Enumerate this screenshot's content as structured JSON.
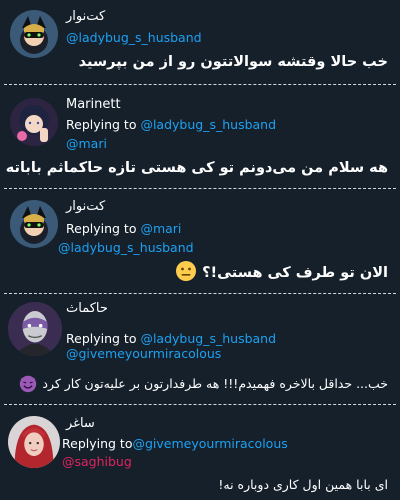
{
  "posts": [
    {
      "name": "کت‌نوار",
      "handle": "@ladybug_s_husband",
      "text": "خب حالا وقتشه سوالاتتون رو از من بپرسید",
      "avatar_icon": "cat-noir-avatar"
    },
    {
      "name": "Marinett",
      "reply_prefix": "Replying to ",
      "reply_to": "@ladybug_s_husband",
      "handle": "@mari",
      "text": "هه سلام من می‌دونم تو کی هستی تازه حاکماثم باباته",
      "avatar_icon": "marinette-avatar"
    },
    {
      "name": "کت‌نوار",
      "reply_prefix": "Replying to ",
      "reply_to": "@mari",
      "handle": "@ladybug_s_husband",
      "text": "الان تو طرف کی هستی!؟",
      "emoji": "neutral-face-emoji",
      "avatar_icon": "cat-noir-avatar"
    },
    {
      "name": "حاکماث",
      "reply_prefix": "Replying to ",
      "reply_to": "@ladybug_s_husband",
      "handle": "@givemeyourmiracolous",
      "text": "خب... حداقل بالاخره فهمیدم!!! هه طرفدارتون بر علیه‌تون کار کرد",
      "emoji": "smiling-devil-emoji",
      "avatar_icon": "hawk-moth-avatar"
    },
    {
      "name": "ساغر",
      "reply_prefix": "Replying to",
      "reply_to": "@givemeyourmiracolous",
      "handle": "@saghibug",
      "text": "ای بابا همین اول کاری دوباره نه!",
      "avatar_icon": "red-hair-avatar"
    }
  ],
  "colors": {
    "background": "#15202b",
    "mention": "#1da1f2",
    "mention_alt": "#e0245e",
    "text": "#ffffff"
  }
}
